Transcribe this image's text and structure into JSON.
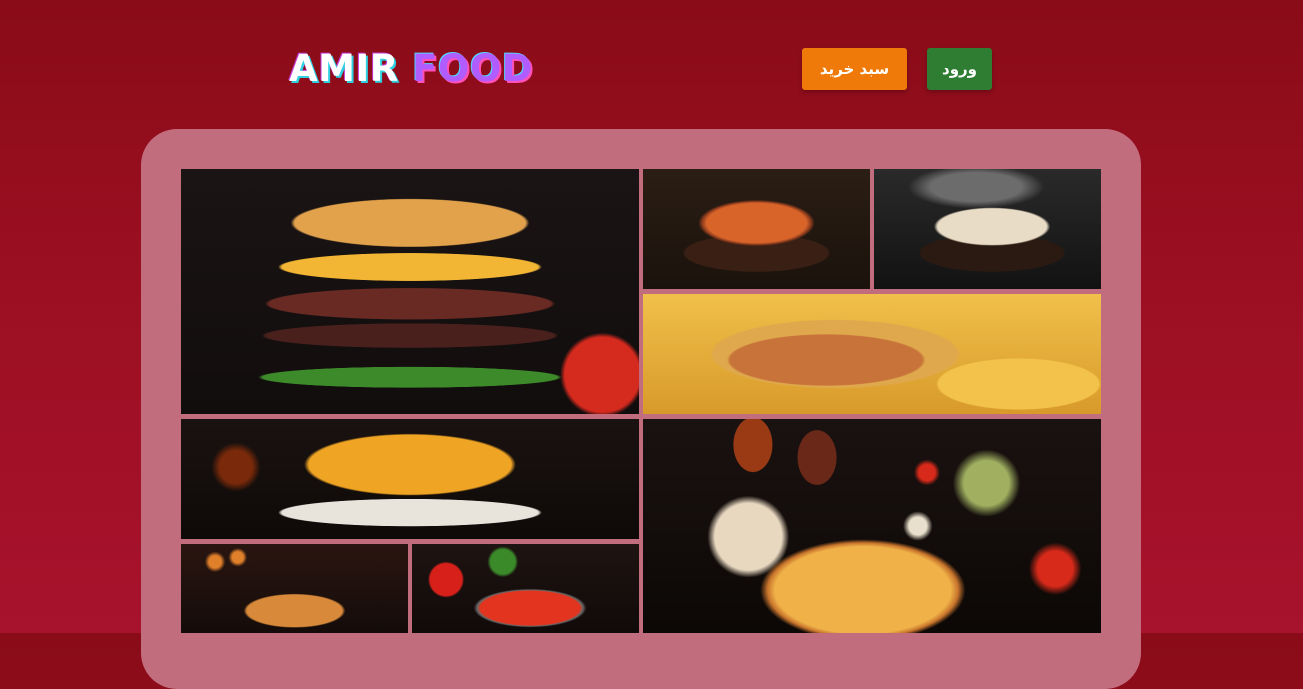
{
  "header": {
    "logo_word1": "AMIR",
    "logo_word2": "FOOD",
    "cart_button_label": "سبد خرید",
    "login_button_label": "ورود"
  },
  "colors": {
    "background": "#9c0f22",
    "panel": "#c26d7e",
    "cart_button": "#f07a09",
    "login_button": "#2e7d32"
  },
  "gallery": {
    "images": [
      {
        "name": "burger-image"
      },
      {
        "name": "curry-image"
      },
      {
        "name": "dumpling-image"
      },
      {
        "name": "hotdog-image"
      },
      {
        "name": "mac-and-cheese-image"
      },
      {
        "name": "pizza-image"
      },
      {
        "name": "schnitzel-image"
      },
      {
        "name": "salad-image"
      }
    ]
  }
}
